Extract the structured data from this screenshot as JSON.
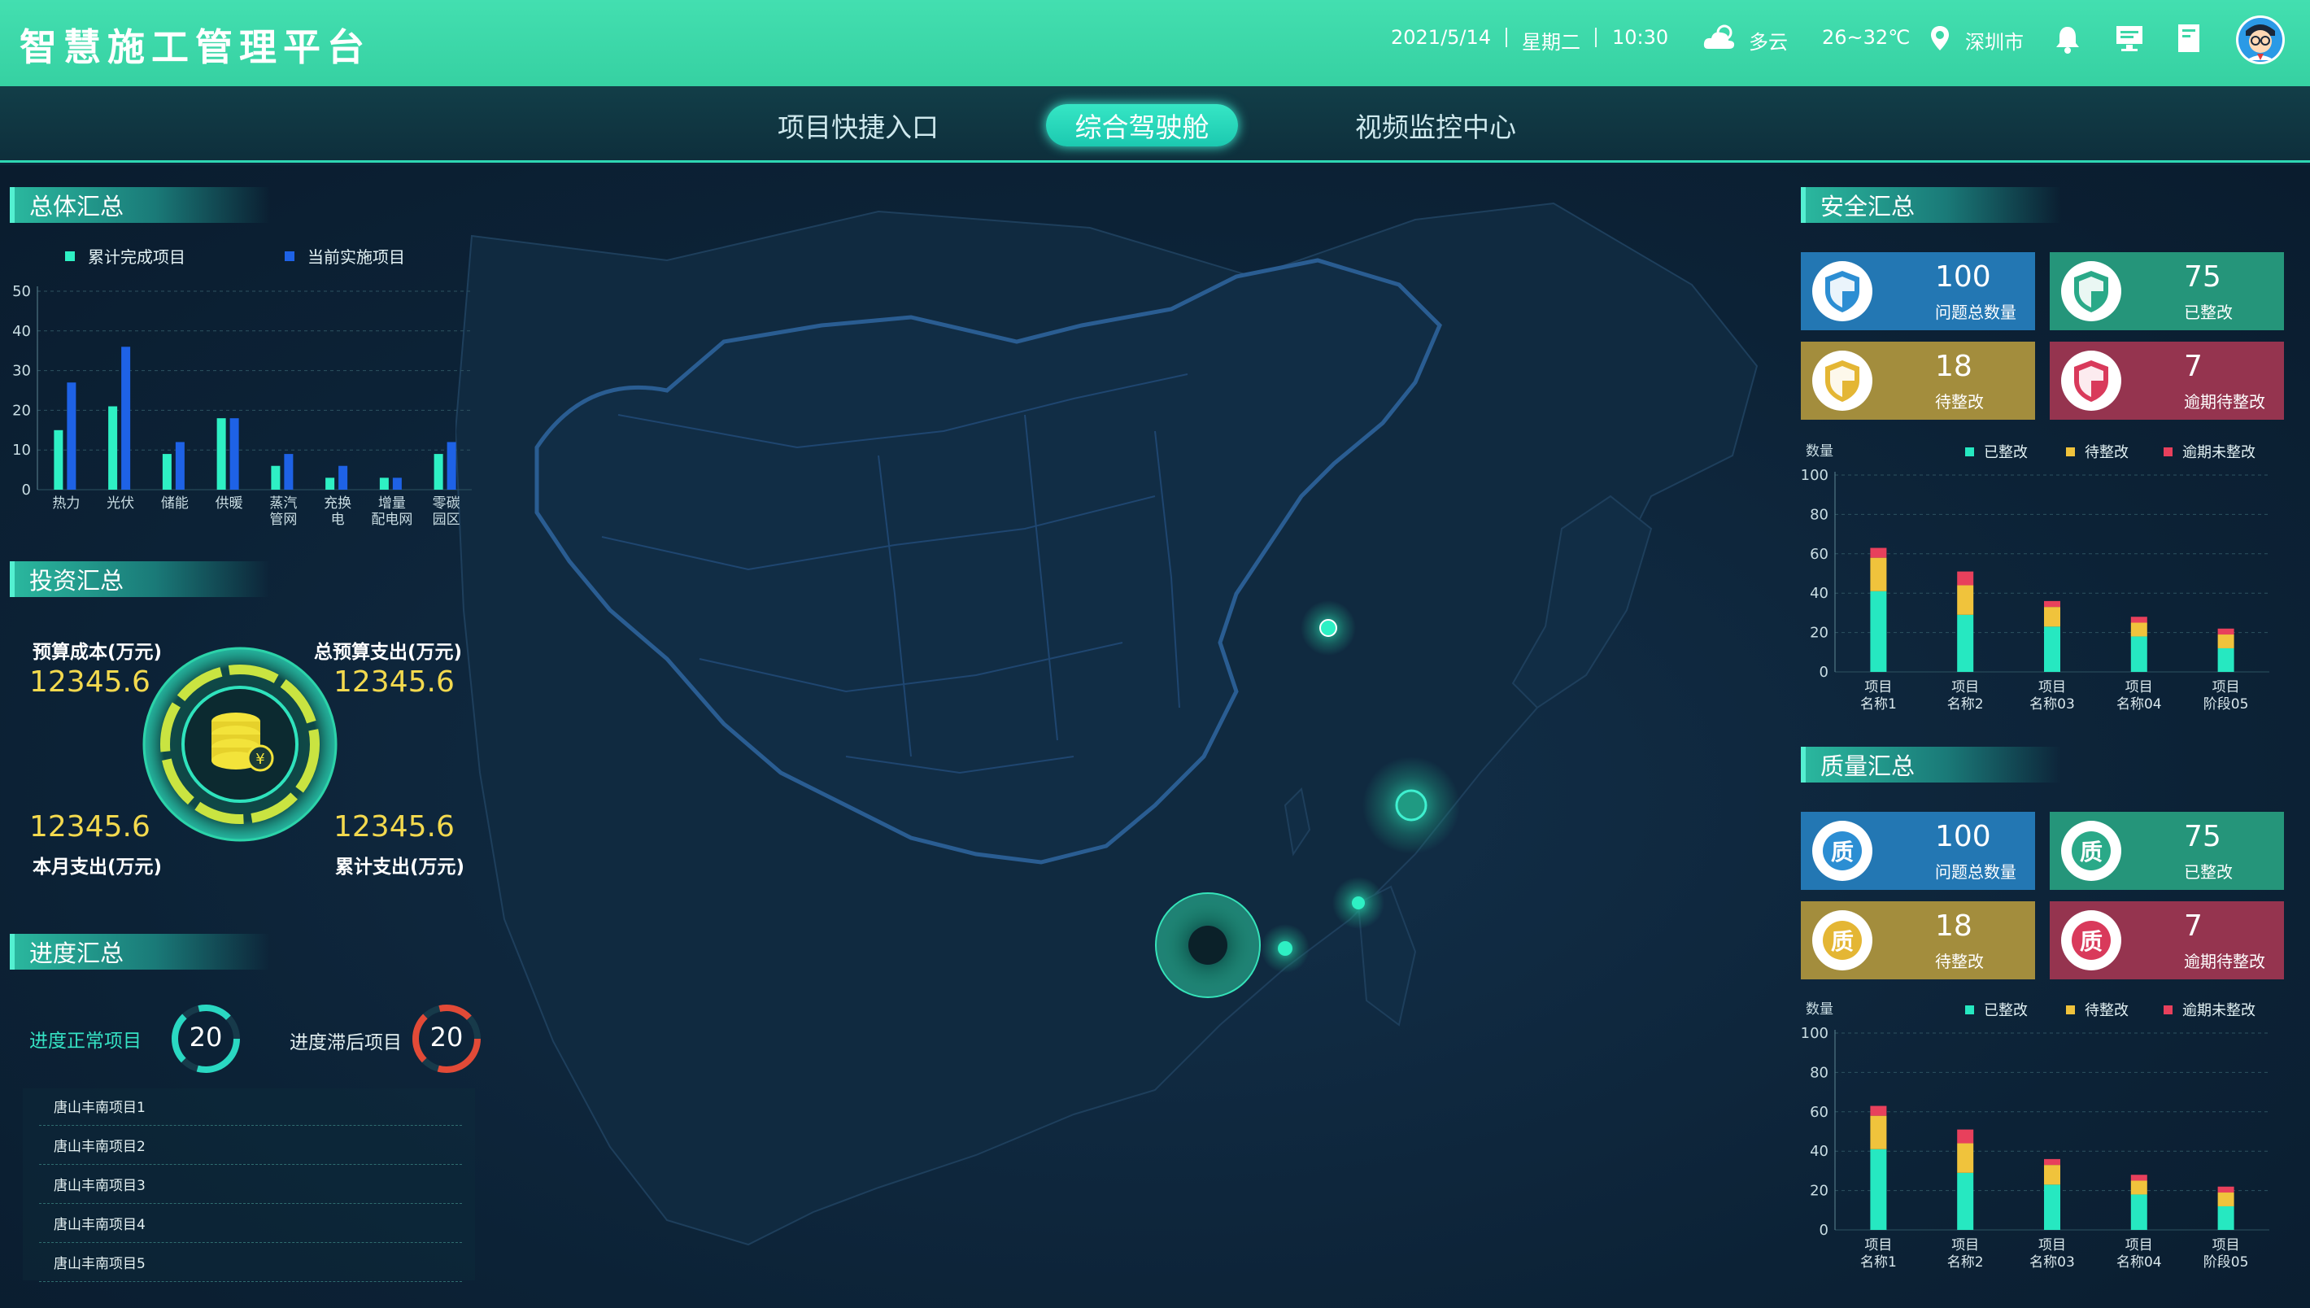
{
  "header": {
    "title": "智慧施工管理平台",
    "date": "2021/5/14",
    "weekday": "星期二",
    "time": "10:30",
    "weather": "多云",
    "temperature": "26~32℃",
    "city": "深圳市"
  },
  "nav": {
    "tabs": [
      {
        "label": "项目快捷入口"
      },
      {
        "label": "综合驾驶舱"
      },
      {
        "label": "视频监控中心"
      }
    ]
  },
  "overview": {
    "title": "总体汇总",
    "legend": [
      "累计完成项目",
      "当前实施项目"
    ],
    "colors": {
      "completed": "#2ef0c4",
      "current": "#1e62e6"
    }
  },
  "investment": {
    "title": "投资汇总",
    "budget_cost_label": "预算成本(万元)",
    "budget_cost_value": "12345.6",
    "total_budget_label": "总预算支出(万元)",
    "total_budget_value": "12345.6",
    "month_spend_label": "本月支出(万元)",
    "month_spend_value": "12345.6",
    "cumulative_label": "累计支出(万元)",
    "cumulative_value": "12345.6"
  },
  "progress": {
    "title": "进度汇总",
    "normal_label": "进度正常项目",
    "normal_count": "20",
    "delayed_label": "进度滞后项目",
    "delayed_count": "20",
    "projects": [
      "唐山丰南项目1",
      "唐山丰南项目2",
      "唐山丰南项目3",
      "唐山丰南项目4",
      "唐山丰南项目5"
    ]
  },
  "safety": {
    "title": "安全汇总",
    "cards": [
      {
        "value": "100",
        "label": "问题总数量",
        "color": "#2377b3",
        "icon_color": "#2c8ed3"
      },
      {
        "value": "75",
        "label": "已整改",
        "color": "#25957a",
        "icon_color": "#2aa988"
      },
      {
        "value": "18",
        "label": "待整改",
        "color": "#a38d3d",
        "icon_color": "#e4b634"
      },
      {
        "value": "7",
        "label": "逾期待整改",
        "color": "#95344f",
        "icon_color": "#d93a5b"
      }
    ]
  },
  "quality": {
    "title": "质量汇总",
    "icon_char": "质",
    "cards": [
      {
        "value": "100",
        "label": "问题总数量",
        "color": "#2377b3",
        "icon_color": "#2c8ed3"
      },
      {
        "value": "75",
        "label": "已整改",
        "color": "#25957a",
        "icon_color": "#2aa988"
      },
      {
        "value": "18",
        "label": "待整改",
        "color": "#a38d3d",
        "icon_color": "#e4b634"
      },
      {
        "value": "7",
        "label": "逾期待整改",
        "color": "#95344f",
        "icon_color": "#d93a5b"
      }
    ]
  },
  "stack_legend": [
    "已整改",
    "待整改",
    "逾期未整改"
  ],
  "stack_colors": [
    "#26e8c1",
    "#f0c33c",
    "#e8405c"
  ],
  "chart_data": [
    {
      "type": "bar",
      "categories": [
        "热力",
        "光伏",
        "储能",
        "供暖",
        "蒸汽管网",
        "充换电",
        "增量配电网",
        "零碳园区"
      ],
      "category_lines": [
        [
          "热力"
        ],
        [
          "光伏"
        ],
        [
          "储能"
        ],
        [
          "供暖"
        ],
        [
          "蒸汽",
          "管网"
        ],
        [
          "充换",
          "电"
        ],
        [
          "增量",
          "配电网"
        ],
        [
          "零碳",
          "园区"
        ]
      ],
      "series": [
        {
          "name": "累计完成项目",
          "values": [
            15,
            21,
            9,
            18,
            6,
            3,
            3,
            9
          ]
        },
        {
          "name": "当前实施项目",
          "values": [
            27,
            36,
            12,
            18,
            9,
            6,
            3,
            12
          ]
        }
      ],
      "ylim": [
        0,
        50
      ],
      "yticks": [
        0,
        10,
        20,
        30,
        40,
        50
      ]
    },
    {
      "type": "bar",
      "stacked": true,
      "ylabel": "数量",
      "categories": [
        "项目名称1",
        "项目名称2",
        "项目名称03",
        "项目名称04",
        "项目阶段05"
      ],
      "category_lines": [
        [
          "项目",
          "名称1"
        ],
        [
          "项目",
          "名称2"
        ],
        [
          "项目",
          "名称03"
        ],
        [
          "项目",
          "名称04"
        ],
        [
          "项目",
          "阶段05"
        ]
      ],
      "series": [
        {
          "name": "已整改",
          "values": [
            41,
            29,
            23,
            18,
            12
          ]
        },
        {
          "name": "待整改",
          "values": [
            17,
            15,
            10,
            7,
            7
          ]
        },
        {
          "name": "逾期未整改",
          "values": [
            5,
            7,
            3,
            3,
            3
          ]
        }
      ],
      "ylim": [
        0,
        100
      ],
      "yticks": [
        0,
        20,
        40,
        60,
        80,
        100
      ]
    },
    {
      "type": "bar",
      "stacked": true,
      "ylabel": "数量",
      "categories": [
        "项目名称1",
        "项目名称2",
        "项目名称03",
        "项目名称04",
        "项目阶段05"
      ],
      "category_lines": [
        [
          "项目",
          "名称1"
        ],
        [
          "项目",
          "名称2"
        ],
        [
          "项目",
          "名称03"
        ],
        [
          "项目",
          "名称04"
        ],
        [
          "项目",
          "阶段05"
        ]
      ],
      "series": [
        {
          "name": "已整改",
          "values": [
            41,
            29,
            23,
            18,
            12
          ]
        },
        {
          "name": "待整改",
          "values": [
            17,
            15,
            10,
            7,
            7
          ]
        },
        {
          "name": "逾期未整改",
          "values": [
            5,
            7,
            3,
            3,
            3
          ]
        }
      ],
      "ylim": [
        0,
        100
      ],
      "yticks": [
        0,
        20,
        40,
        60,
        80,
        100
      ]
    }
  ]
}
